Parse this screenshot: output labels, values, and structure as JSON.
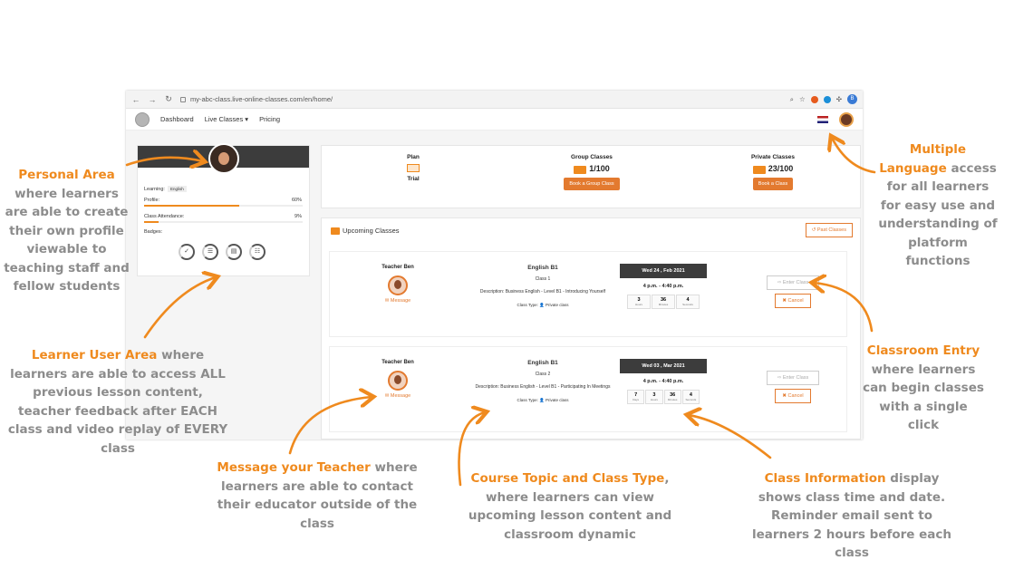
{
  "browser": {
    "url": "my-abc-class.live-online-classes.com/en/home/",
    "profile_initial": "B"
  },
  "navbar": {
    "dashboard": "Dashboard",
    "live_classes": "Live Classes ▾",
    "pricing": "Pricing"
  },
  "profile": {
    "learning_label": "Learning:",
    "learning_value": "English",
    "profile_label": "Profile:",
    "profile_pct": "60%",
    "profile_fraction": 0.6,
    "attendance_label": "Class Attendance:",
    "attendance_pct": "9%",
    "attendance_fraction": 0.09,
    "badges_label": "Badges:"
  },
  "plan": {
    "plan_title": "Plan",
    "plan_value": "Trial",
    "group_title": "Group Classes",
    "group_count": "1/100",
    "group_button": "Book a Group Class",
    "private_title": "Private Classes",
    "private_count": "23/100",
    "private_button": "Book a Class"
  },
  "upcoming": {
    "title": "Upcoming Classes",
    "past_button": "Past Classes",
    "classes": [
      {
        "teacher": "Teacher Ben",
        "message": "✉ Message",
        "course": "English B1",
        "class_no": "Class 1",
        "description": "Description: Business English - Level B1 - Introducing Yourself",
        "class_type": "Class Type: 👤 Private class",
        "date": "Wed 24 , Feb 2021",
        "time": "4 p.m. - 4:40 p.m.",
        "countdown": [
          {
            "value": "3",
            "unit": "Hours"
          },
          {
            "value": "36",
            "unit": "Minutes"
          },
          {
            "value": "4",
            "unit": "Seconds"
          }
        ],
        "enter": "⇨ Enter Class",
        "cancel": "✖ Cancel"
      },
      {
        "teacher": "Teacher Ben",
        "message": "✉ Message",
        "course": "English B1",
        "class_no": "Class 2",
        "description": "Description: Business English - Level B1 - Participating In Meetings",
        "class_type": "Class Type: 👤 Private class",
        "date": "Wed 03 , Mar 2021",
        "time": "4 p.m. - 4:40 p.m.",
        "countdown": [
          {
            "value": "7",
            "unit": "Days"
          },
          {
            "value": "3",
            "unit": "Hours"
          },
          {
            "value": "36",
            "unit": "Minutes"
          },
          {
            "value": "4",
            "unit": "Seconds"
          }
        ],
        "enter": "⇨ Enter Class",
        "cancel": "✖ Cancel"
      }
    ]
  },
  "annotations": {
    "personal_hl": "Personal Area",
    "personal_text": "where learners are able to create their own profile viewable to teaching staff and fellow students",
    "learner_hl": "Learner User Area",
    "learner_text": "where learners are able to access ALL previous lesson content, teacher feedback after EACH class and video replay of EVERY class",
    "message_hl": "Message your Teacher",
    "message_text": "where learners are able to contact their educator outside of the class",
    "course_hl": "Course Topic and Class Type",
    "course_text": ", where learners can view upcoming lesson content and classroom dynamic",
    "classinfo_hl": "Class Information",
    "classinfo_text": "display shows class time and date. Reminder email sent to learners 2 hours before each class",
    "language_hl": "Multiple Language",
    "language_text": "access for all learners for easy use and understanding of platform functions",
    "classroom_hl": "Classroom Entry",
    "classroom_text": "where learners can begin classes with a single click"
  },
  "colors": {
    "accent": "#ef8a1e",
    "annotation_text": "#8c8c8c",
    "button_orange": "#e37a2f",
    "header_dark": "#3c3c3c"
  }
}
